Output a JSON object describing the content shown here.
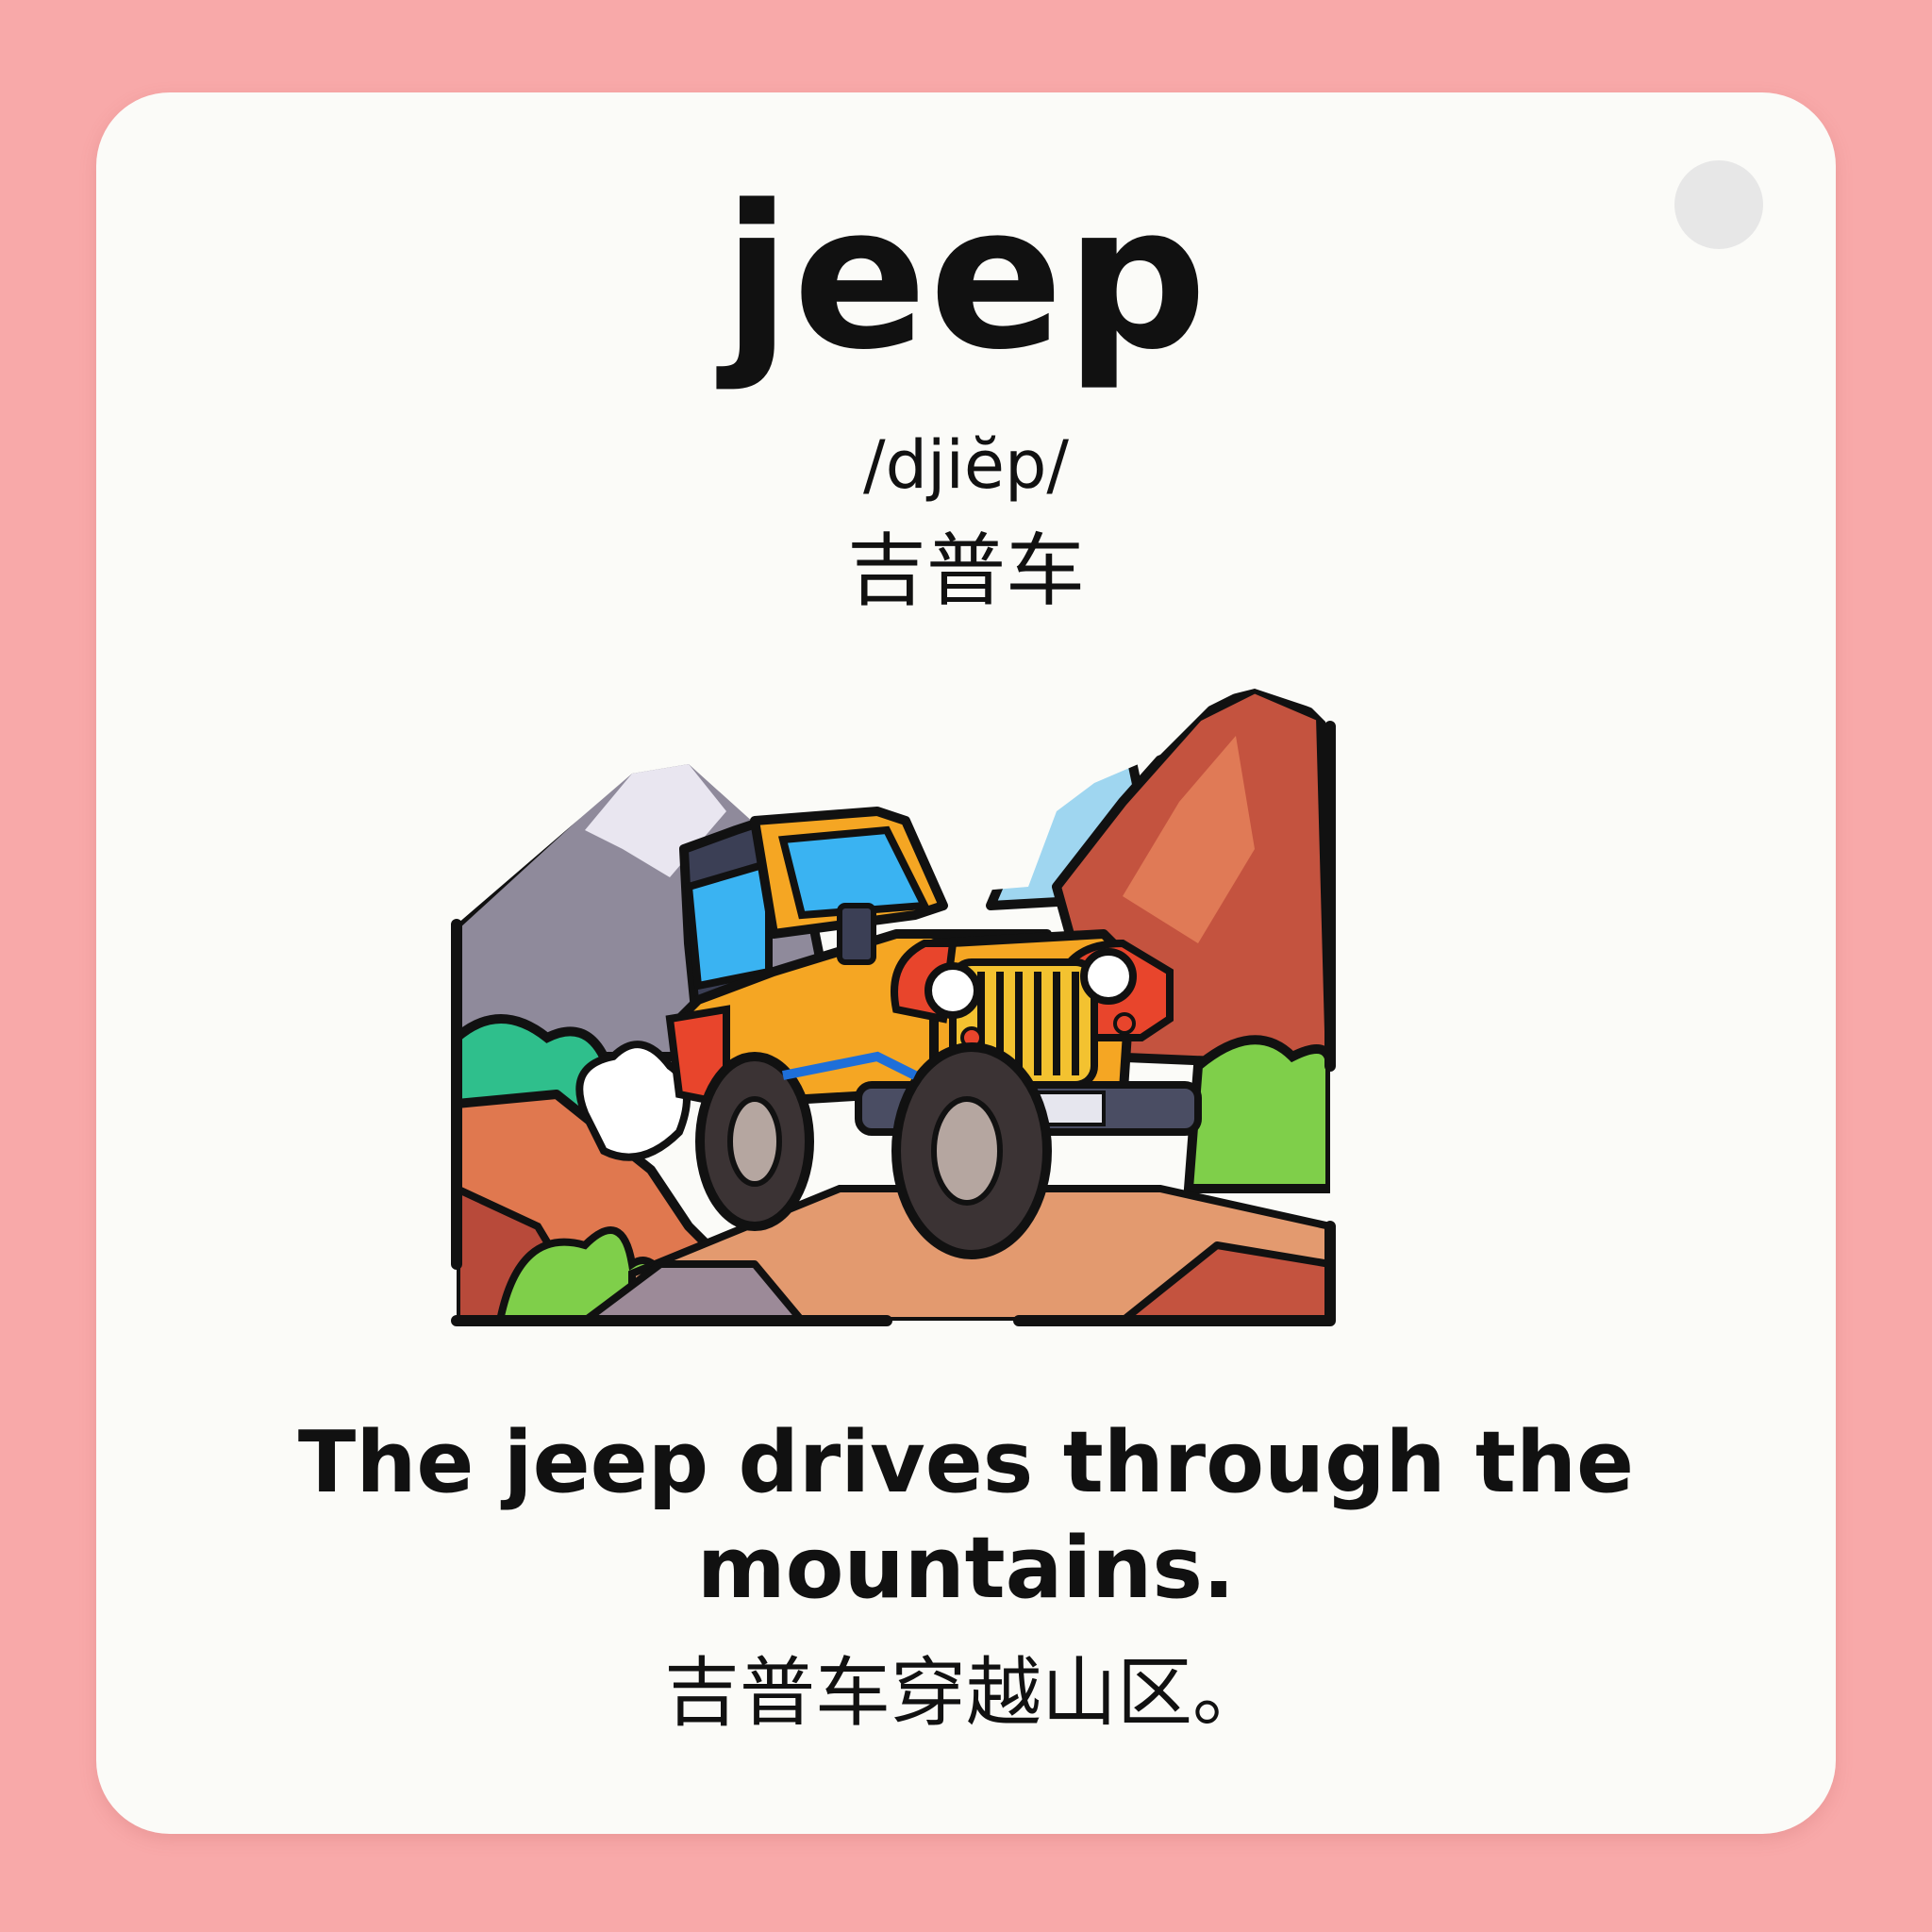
{
  "card": {
    "word": "jeep",
    "phonetic": "/djiĕp/",
    "translation": "吉普车",
    "sentence": "The jeep drives through the mountains.",
    "sentence_translation": "吉普车穿越山区。"
  },
  "illustration": {
    "subject": "jeep driving on a mountain dirt road",
    "colors": {
      "page_bg": "#f8a9a9",
      "card_bg": "#fbfbf8",
      "jeep_body": "#f5a623",
      "jeep_front": "#e8452c",
      "windshield": "#3ab3f2",
      "mountain_gray": "#8f8a9b",
      "mountain_red": "#c4533f",
      "grass": "#7fcf4a",
      "road": "#e39a6f"
    }
  }
}
